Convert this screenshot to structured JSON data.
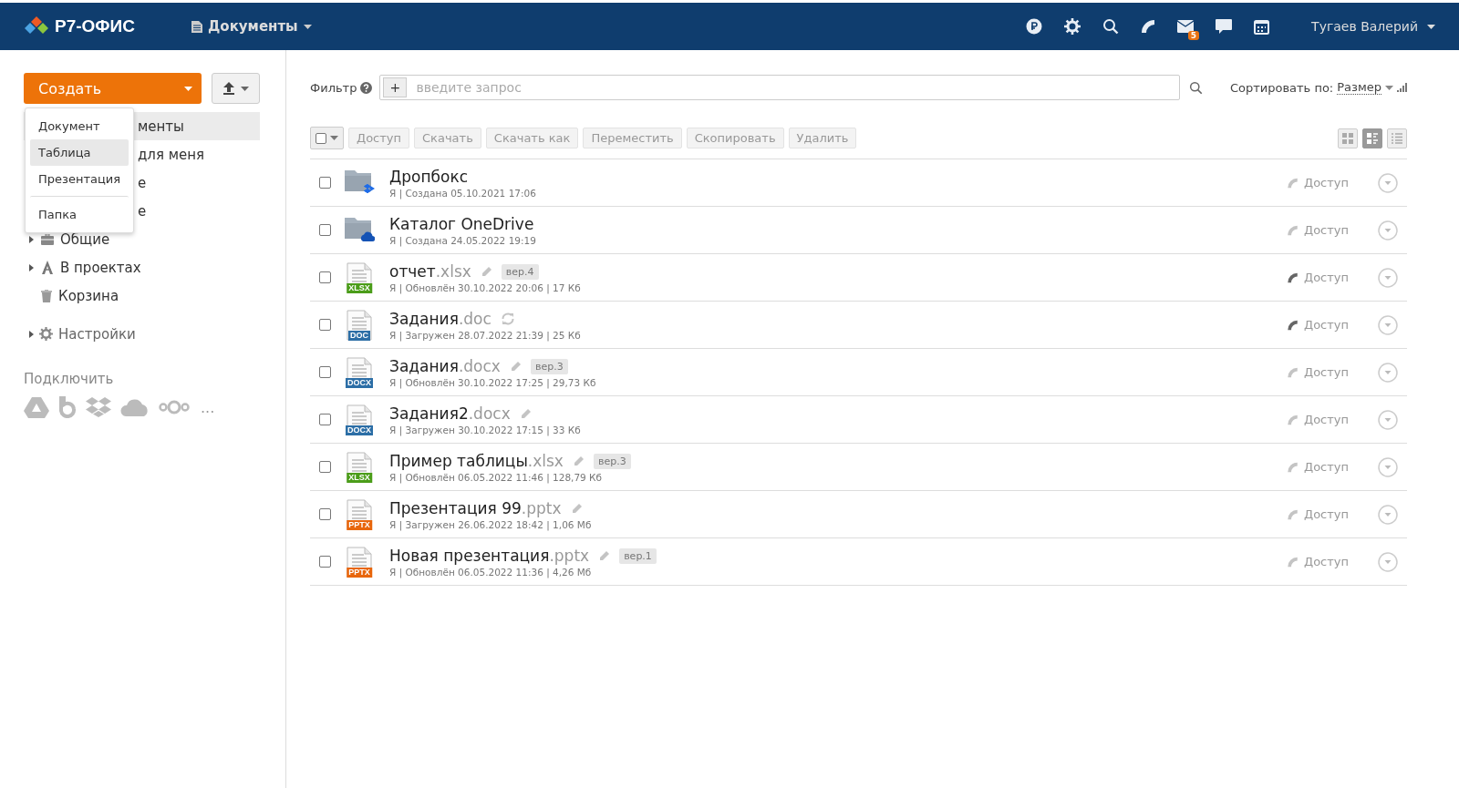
{
  "header": {
    "logo": "Р7-ОФИС",
    "module": "Документы",
    "user": "Тугаев Валерий",
    "mail_badge": "5"
  },
  "sidebar": {
    "create_button": "Создать",
    "create_menu": [
      {
        "label": "Документ",
        "selected": false,
        "kind": "item"
      },
      {
        "label": "Таблица",
        "selected": true,
        "kind": "item"
      },
      {
        "label": "Презентация",
        "selected": false,
        "kind": "item"
      },
      {
        "label": "Папка",
        "selected": false,
        "kind": "separated"
      }
    ],
    "hidden_items": [
      {
        "label": "менты",
        "selected": true
      },
      {
        "label": "для меня",
        "selected": false
      },
      {
        "label": "е",
        "selected": false
      },
      {
        "label": "е",
        "selected": false
      }
    ],
    "tree": [
      {
        "label": "Общие",
        "kind": "briefcase",
        "expandable": true
      },
      {
        "label": "В проектах",
        "kind": "projects",
        "expandable": true
      },
      {
        "label": "Корзина",
        "kind": "trash",
        "expandable": false
      }
    ],
    "settings": "Настройки",
    "connect_title": "Подключить",
    "more": "..."
  },
  "filter": {
    "label": "Фильтр",
    "add": "+",
    "placeholder": "введите запрос",
    "sort_label": "Сортировать по:",
    "sort_value": "Размер"
  },
  "toolbar": {
    "select_all_checked": false,
    "buttons": [
      "Доступ",
      "Скачать",
      "Скачать как",
      "Переместить",
      "Скопировать",
      "Удалить"
    ],
    "views": [
      {
        "kind": "tiles",
        "selected": false
      },
      {
        "kind": "compact",
        "selected": true
      },
      {
        "kind": "list",
        "selected": false
      }
    ]
  },
  "files": [
    {
      "kind": "folder-dropbox",
      "name": "Дропбокс",
      "checked": false,
      "meta": "Я | Создана 05.10.2021 17:06",
      "access": "Доступ",
      "shared": false
    },
    {
      "kind": "folder-onedrive",
      "name": "Каталог OneDrive",
      "checked": false,
      "meta": "Я | Создана 24.05.2022 19:19",
      "access": "Доступ",
      "shared": false
    },
    {
      "kind": "xlsx",
      "icon_label": "XLSX",
      "name": "отчет",
      "ext": ".xlsx",
      "editing": true,
      "checked": false,
      "version": "вер.4",
      "meta": "Я | Обновлён 30.10.2022 20:06 | 17 Кб",
      "access": "Доступ",
      "shared": true
    },
    {
      "kind": "doc",
      "icon_label": "DOC",
      "name": "Задания",
      "ext": ".doc",
      "syncing": true,
      "checked": false,
      "meta": "Я | Загружен 28.07.2022 21:39 | 25 Кб",
      "access": "Доступ",
      "shared": true
    },
    {
      "kind": "doc",
      "icon_label": "DOCX",
      "name": "Задания",
      "ext": ".docx",
      "editing": true,
      "checked": false,
      "version": "вер.3",
      "meta": "Я | Обновлён 30.10.2022 17:25 | 29,73 Кб",
      "access": "Доступ",
      "shared": false
    },
    {
      "kind": "doc",
      "icon_label": "DOCX",
      "name": "Задания2",
      "ext": ".docx",
      "editing": true,
      "checked": false,
      "meta": "Я | Загружен 30.10.2022 17:15 | 33 Кб",
      "access": "Доступ",
      "shared": false
    },
    {
      "kind": "xlsx",
      "icon_label": "XLSX",
      "name": "Пример таблицы",
      "ext": ".xlsx",
      "editing": true,
      "checked": false,
      "version": "вер.3",
      "meta": "Я | Обновлён 06.05.2022 11:46 | 128,79 Кб",
      "access": "Доступ",
      "shared": false
    },
    {
      "kind": "pptx",
      "icon_label": "PPTX",
      "name": "Презентация 99",
      "ext": ".pptx",
      "editing": true,
      "checked": false,
      "meta": "Я | Загружен 26.06.2022 18:42 | 1,06 Мб",
      "access": "Доступ",
      "shared": false
    },
    {
      "kind": "pptx",
      "icon_label": "PPTX",
      "name": "Новая презентация",
      "ext": ".pptx",
      "editing": true,
      "checked": false,
      "version": "вер.1",
      "meta": "Я | Обновлён 06.05.2022 11:36 | 4,26 Мб",
      "access": "Доступ",
      "shared": false
    }
  ]
}
